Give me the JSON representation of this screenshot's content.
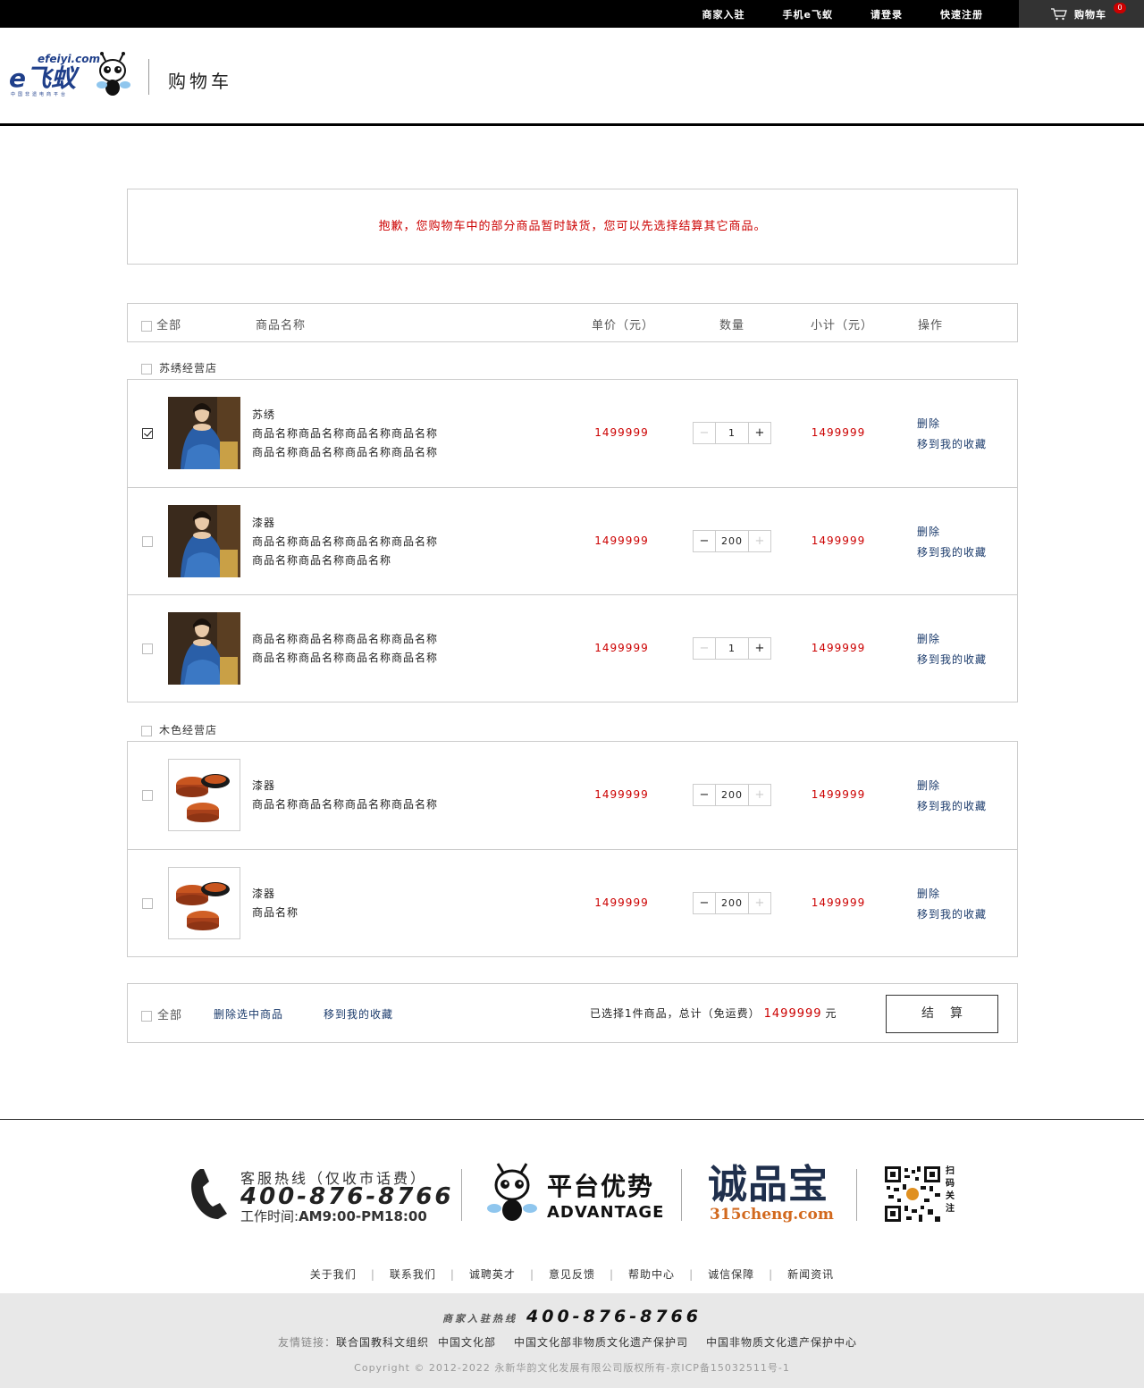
{
  "topbar": {
    "links": [
      "商家入驻",
      "手机e飞蚁",
      "请登录",
      "快速注册"
    ],
    "cart_label": "购物车",
    "cart_count": "0"
  },
  "header": {
    "logo_text": "efeiyi.com",
    "logo_brand": "e飞蚁",
    "logo_slogan": "中国非遗电商平台",
    "title": "购物车"
  },
  "notice": "抱歉，您购物车中的部分商品暂时缺货，您可以先选择结算其它商品。",
  "table_head": {
    "all": "全部",
    "name": "商品名称",
    "price": "单价（元）",
    "qty": "数量",
    "subtotal": "小计（元）",
    "ops": "操作"
  },
  "shops": [
    {
      "name": "苏绣经营店",
      "items": [
        {
          "title": "苏绣",
          "lines": [
            "商品名称商品名称商品名称商品名称",
            "商品名称商品名称商品名称商品名称"
          ],
          "price": "1499999",
          "qty": "1",
          "subtotal": "1499999",
          "checked": true,
          "image": "portrait",
          "minus_disabled": true,
          "plus_disabled": false
        },
        {
          "title": "漆器",
          "lines": [
            "商品名称商品名称商品名称商品名称",
            "商品名称商品名称商品名称"
          ],
          "price": "1499999",
          "qty": "200",
          "subtotal": "1499999",
          "checked": false,
          "image": "portrait",
          "minus_disabled": false,
          "plus_disabled": true
        },
        {
          "title": "",
          "lines": [
            "商品名称商品名称商品名称商品名称",
            "商品名称商品名称商品名称商品名称"
          ],
          "price": "1499999",
          "qty": "1",
          "subtotal": "1499999",
          "checked": false,
          "image": "portrait",
          "minus_disabled": true,
          "plus_disabled": false
        }
      ]
    },
    {
      "name": "木色经营店",
      "items": [
        {
          "title": "漆器",
          "lines": [
            "商品名称商品名称商品名称商品名称"
          ],
          "price": "1499999",
          "qty": "200",
          "subtotal": "1499999",
          "checked": false,
          "image": "lacquer",
          "minus_disabled": false,
          "plus_disabled": true
        },
        {
          "title": "漆器",
          "lines": [
            "商品名称"
          ],
          "price": "1499999",
          "qty": "200",
          "subtotal": "1499999",
          "checked": false,
          "image": "lacquer",
          "minus_disabled": false,
          "plus_disabled": true
        }
      ]
    }
  ],
  "ops": {
    "delete": "删除",
    "move_fav": "移到我的收藏"
  },
  "bar": {
    "all": "全部",
    "delete_selected": "删除选中商品",
    "move_fav": "移到我的收藏",
    "summary_pre": "已选择1件商品，总计（免运费）",
    "total": "1499999",
    "unit": "元",
    "checkout": "结算"
  },
  "footer": {
    "hotline_title": "客服热线（仅收市话费）",
    "hotline_number": "400-876-8766",
    "work_time_label": "工作时间:",
    "work_time": "AM9:00-PM18:00",
    "adv_title": "平台优势",
    "adv_sub": "ADVANTAGE",
    "cpb_title": "诚品宝",
    "cpb_url": "315cheng.com",
    "qr_label": "扫码关注",
    "nav": [
      "关于我们",
      "联系我们",
      "诚聘英才",
      "意见反馈",
      "帮助中心",
      "诚信保障",
      "新闻资讯"
    ],
    "merchant_hotline_label": "商家入驻热线",
    "merchant_hotline": "400-876-8766",
    "friends_prefix": "友情链接：",
    "friends": [
      "联合国教科文组织",
      "中国文化部",
      "中国文化部非物质文化遗产保护司",
      "中国非物质文化遗产保护中心"
    ],
    "copyright": "Copyright © 2012-2022 永新华韵文化发展有限公司版权所有-京ICP备15032511号-1"
  },
  "colors": {
    "accent_red": "#cc0000",
    "link_blue": "#1a3a6b",
    "topbar_bg": "#000000"
  }
}
